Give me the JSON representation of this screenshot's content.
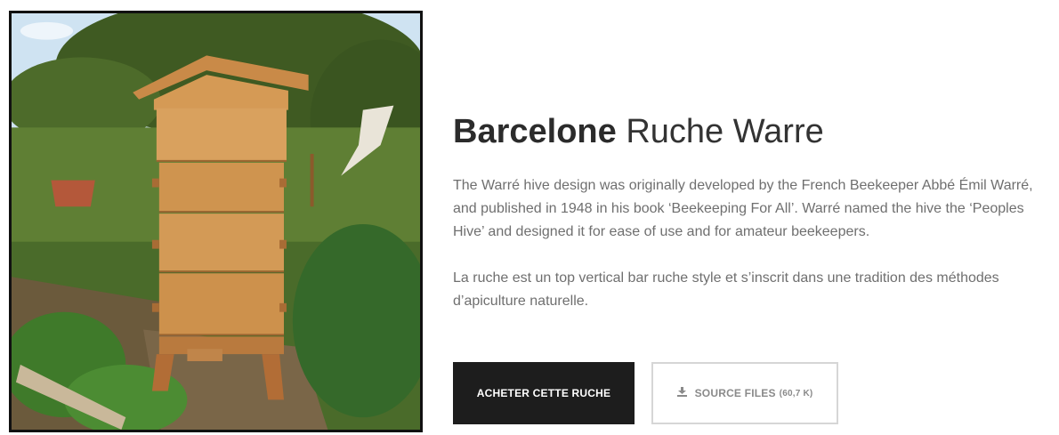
{
  "product": {
    "title_strong": "Barcelone",
    "title_rest": "Ruche Warre",
    "paragraphs": [
      "The Warré hive design was originally developed by the French Beekeeper Abbé Émil Warré, and published in 1948 in his book ‘Beekeeping For All’. Warré named the hive the ‘Peoples Hive’ and designed it for ease of use and for amateur beekeepers.",
      "La ruche est un top vertical bar ruche style et s’inscrit dans une tradition des méthodes d’apiculture naturelle."
    ]
  },
  "buttons": {
    "buy_label": "ACHETER CETTE RUCHE",
    "source_label": "SOURCE FILES",
    "source_size": "(60,7 K)",
    "source_icon": "download-icon"
  },
  "image": {
    "subject": "warre-hive-photo"
  },
  "colors": {
    "button_dark": "#1d1d1d",
    "button_border": "#d6d6d6",
    "text": "#6f6f6f",
    "title": "#333333"
  }
}
